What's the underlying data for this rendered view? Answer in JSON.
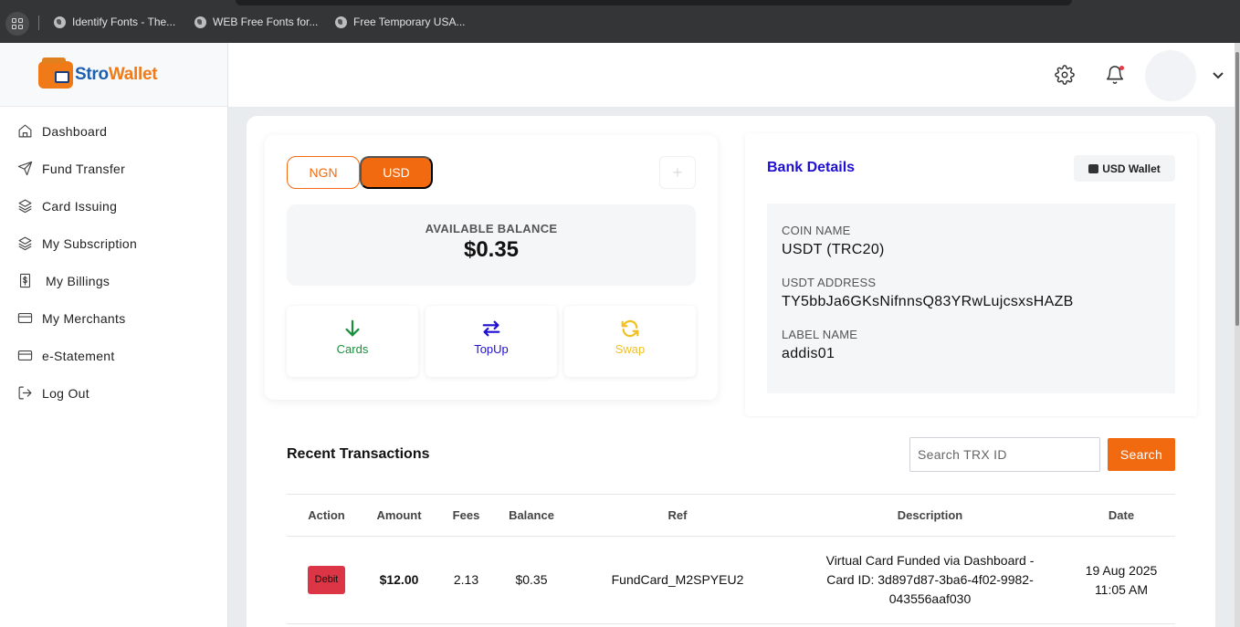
{
  "browser": {
    "bookmarks": [
      {
        "label": "Identify Fonts - The...",
        "icon": "globe-icon"
      },
      {
        "label": "WEB Free Fonts for...",
        "icon": "globe-icon"
      },
      {
        "label": "Free Temporary USA...",
        "icon": "globe-icon"
      }
    ]
  },
  "brand": {
    "part1": "Stro",
    "part2": "Wallet",
    "primary_color": "#1c5fb1",
    "accent_color": "#f07a17"
  },
  "sidebar": {
    "items": [
      {
        "label": "Dashboard",
        "icon": "home-icon"
      },
      {
        "label": "Fund Transfer",
        "icon": "send-icon"
      },
      {
        "label": "Card Issuing",
        "icon": "layers-icon"
      },
      {
        "label": "My Subscription",
        "icon": "layers-icon"
      },
      {
        "label": "My Billings",
        "icon": "dollar-icon"
      },
      {
        "label": "My Merchants",
        "icon": "credit-card-icon"
      },
      {
        "label": "e-Statement",
        "icon": "credit-card-icon"
      },
      {
        "label": "Log Out",
        "icon": "logout-icon"
      }
    ]
  },
  "header": {
    "icons": [
      "gear-icon",
      "bell-icon",
      "avatar",
      "chevron-down-icon"
    ]
  },
  "wallet": {
    "currencies": [
      "NGN",
      "USD"
    ],
    "selected_currency": "USD",
    "plus": "+",
    "balance_label": "AVAILABLE BALANCE",
    "balance_value": "$0.35",
    "actions": [
      {
        "label": "Cards",
        "icon": "arrow-down-icon",
        "color": "#1a8f3b"
      },
      {
        "label": "TopUp",
        "icon": "exchange-icon",
        "color": "#1f0fd1"
      },
      {
        "label": "Swap",
        "icon": "refresh-icon",
        "color": "#f2c021"
      }
    ]
  },
  "bank": {
    "title": "Bank Details",
    "wallet_badge": "USD Wallet",
    "fields": [
      {
        "label": "COIN NAME",
        "value": "USDT (TRC20)"
      },
      {
        "label": "USDT ADDRESS",
        "value": "TY5bbJa6GKsNifnnsQ83YRwLujcsxsHAZB"
      },
      {
        "label": "LABEL NAME",
        "value": "addis01"
      }
    ]
  },
  "transactions": {
    "title": "Recent Transactions",
    "search_placeholder": "Search TRX ID",
    "search_button": "Search",
    "columns": [
      "Action",
      "Amount",
      "Fees",
      "Balance",
      "Ref",
      "Description",
      "Date"
    ],
    "rows": [
      {
        "action": "Debit",
        "amount": "$12.00",
        "fees": "2.13",
        "balance": "$0.35",
        "ref": "FundCard_M2SPYEU2",
        "description": "Virtual Card Funded via Dashboard - Card ID: 3d897d87-3ba6-4f02-9982-043556aaf030",
        "date": "19 Aug 2025 11:05 AM"
      }
    ]
  }
}
